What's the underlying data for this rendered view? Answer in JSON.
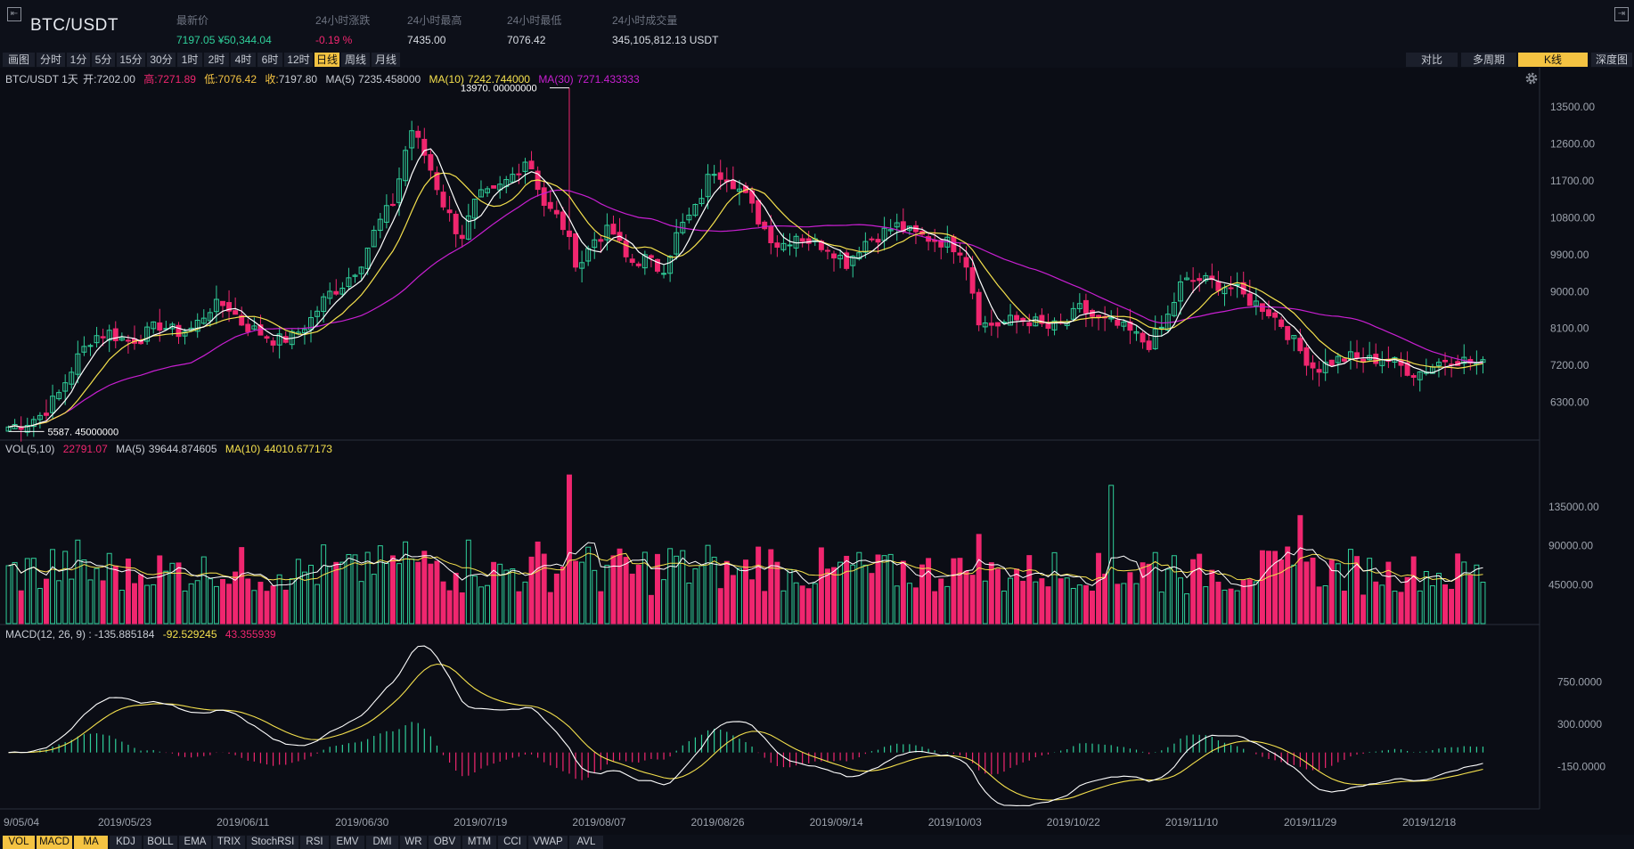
{
  "header": {
    "pair": "BTC/USDT",
    "stats": [
      {
        "label": "最新价",
        "value": "7197.05 ¥50,344.04",
        "color": "#2fcf9a"
      },
      {
        "label": "24小时涨跌",
        "value": "-0.19 %",
        "color": "#f0266f"
      },
      {
        "label": "24小时最高",
        "value": "7435.00",
        "color": "#d8dce3"
      },
      {
        "label": "24小时最低",
        "value": "7076.42",
        "color": "#d8dce3"
      },
      {
        "label": "24小时成交量",
        "value": "345,105,812.13 USDT",
        "color": "#d8dce3"
      }
    ]
  },
  "toolbar": {
    "intervals": [
      "画图",
      "分时",
      "1分",
      "5分",
      "15分",
      "30分",
      "1时",
      "2时",
      "4时",
      "6时",
      "12时",
      "日线",
      "周线",
      "月线"
    ],
    "active_interval": "日线",
    "views": [
      "对比",
      "多周期",
      "K线",
      "深度图"
    ],
    "active_view": "K线"
  },
  "kline_info": {
    "pair_interval": "BTC/USDT 1天",
    "open_label": "开:",
    "open": "7202.00",
    "high_label": "高:",
    "high": "7271.89",
    "low_label": "低:",
    "low": "7076.42",
    "close_label": "收:",
    "close": "7197.80",
    "ma5_label": "MA(5)",
    "ma5": "7235.458000",
    "ma10_label": "MA(10)",
    "ma10": "7242.744000",
    "ma30_label": "MA(30)",
    "ma30": "7271.433333"
  },
  "vol_info": {
    "label": "VOL(5,10)",
    "vol": "22791.07",
    "ma5_label": "MA(5)",
    "ma5": "39644.874605",
    "ma10_label": "MA(10)",
    "ma10": "44010.677173"
  },
  "macd_info": {
    "label": "MACD(12, 26, 9) : -135.885184",
    "dea": "-92.529245",
    "hist": "43.355939"
  },
  "annotations": {
    "max_label": "13970. 00000000",
    "min_label": "5587. 45000000"
  },
  "colors": {
    "up": "#2fcf9a",
    "down": "#f0266f",
    "ma5": "#ffffff",
    "ma10": "#f4e04d",
    "ma30": "#c81fd1",
    "accent": "#f4c342"
  },
  "bottom_indicators": [
    "VOL",
    "MACD",
    "MA",
    "KDJ",
    "BOLL",
    "EMA",
    "TRIX",
    "StochRSI",
    "RSI",
    "EMV",
    "DMI",
    "WR",
    "OBV",
    "MTM",
    "CCI",
    "VWAP",
    "AVL"
  ],
  "active_indicators": [
    "VOL",
    "MACD",
    "MA"
  ],
  "chart_data": {
    "type": "candlestick",
    "price_axis_ticks": [
      "13500.00",
      "12600.00",
      "11700.00",
      "10800.00",
      "9900.00",
      "9000.00",
      "8100.00",
      "7200.00",
      "6300.00"
    ],
    "volume_axis_ticks": [
      "135000.00",
      "90000.00",
      "45000.00"
    ],
    "macd_axis_ticks": [
      "750.0000",
      "300.0000",
      "-150.0000"
    ],
    "date_labels": [
      "9/05/04",
      "2019/05/23",
      "2019/06/11",
      "2019/06/30",
      "2019/07/19",
      "2019/08/07",
      "2019/08/26",
      "2019/09/14",
      "2019/10/03",
      "2019/10/22",
      "2019/11/10",
      "2019/11/29",
      "2019/12/18"
    ],
    "price_close_path": [
      5700,
      5800,
      6000,
      6500,
      7300,
      7900,
      8000,
      7800,
      7900,
      8200,
      8000,
      8100,
      8600,
      8700,
      8200,
      8000,
      7800,
      7900,
      8300,
      8900,
      9200,
      9700,
      10600,
      11200,
      13000,
      12200,
      11100,
      10300,
      11300,
      11400,
      11800,
      12300,
      11100,
      10700,
      9600,
      10300,
      10500,
      9700,
      9800,
      9500,
      10500,
      11000,
      12000,
      11800,
      11300,
      10600,
      10100,
      10400,
      10200,
      10100,
      9700,
      10200,
      10400,
      10600,
      10400,
      10300,
      10200,
      10000,
      8200,
      8200,
      8300,
      8300,
      8100,
      8200,
      8600,
      8300,
      8200,
      8000,
      7700,
      8200,
      9200,
      9300,
      9200,
      9100,
      8800,
      8600,
      8200,
      7600,
      7100,
      7300,
      7400,
      7300,
      7400,
      7200,
      7000,
      7200,
      7400,
      7300,
      7200
    ]
  }
}
